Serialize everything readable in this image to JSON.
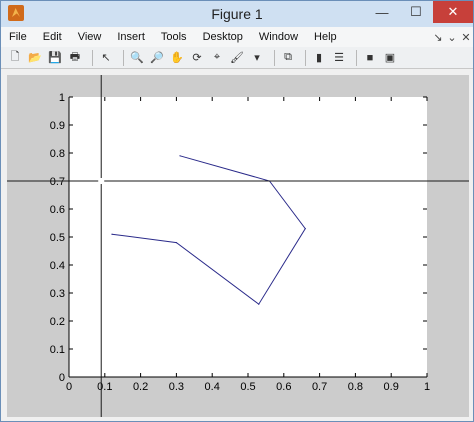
{
  "window": {
    "title": "Figure 1",
    "minimize": "—",
    "maximize": "☐",
    "close": "✕"
  },
  "menu": [
    "File",
    "Edit",
    "View",
    "Insert",
    "Tools",
    "Desktop",
    "Window",
    "Help"
  ],
  "menu_controls": [
    "↘",
    "⌄",
    "✕"
  ],
  "toolbar": [
    {
      "name": "new-figure-icon",
      "glyph": "🗋"
    },
    {
      "name": "open-file-icon",
      "glyph": "📂"
    },
    {
      "name": "save-icon",
      "glyph": "💾"
    },
    {
      "name": "print-icon",
      "glyph": "🖶"
    },
    {
      "sep": true
    },
    {
      "name": "edit-plot-arrow-icon",
      "glyph": "↖"
    },
    {
      "sep": true
    },
    {
      "name": "zoom-in-icon",
      "glyph": "🔍"
    },
    {
      "name": "zoom-out-icon",
      "glyph": "🔎"
    },
    {
      "name": "pan-hand-icon",
      "glyph": "✋"
    },
    {
      "name": "rotate-3d-icon",
      "glyph": "⟳"
    },
    {
      "name": "data-cursor-icon",
      "glyph": "⌖"
    },
    {
      "name": "brush-icon",
      "glyph": "🖌"
    },
    {
      "name": "brush-dropdown-icon",
      "glyph": "▾"
    },
    {
      "sep": true
    },
    {
      "name": "link-plot-icon",
      "glyph": "⧉"
    },
    {
      "sep": true
    },
    {
      "name": "colorbar-icon",
      "glyph": "▮"
    },
    {
      "name": "legend-icon",
      "glyph": "☰"
    },
    {
      "sep": true
    },
    {
      "name": "hide-plot-tools-icon",
      "glyph": "■"
    },
    {
      "name": "show-plot-tools-icon",
      "glyph": "▣"
    }
  ],
  "colors": {
    "plot_line": "#2a2a8a",
    "crosshair": "#1a1a1a",
    "axes_bg": "#ffffff",
    "figure_bg": "#cccccc"
  },
  "chart_data": {
    "type": "line",
    "x": [
      0.31,
      0.56,
      0.66,
      0.53,
      0.3,
      0.12
    ],
    "y": [
      0.79,
      0.7,
      0.53,
      0.26,
      0.48,
      0.51
    ],
    "xlim": [
      0,
      1
    ],
    "ylim": [
      0,
      1
    ],
    "xticks": [
      "0",
      "0.1",
      "0.2",
      "0.3",
      "0.4",
      "0.5",
      "0.6",
      "0.7",
      "0.8",
      "0.9",
      "1"
    ],
    "yticks": [
      "0",
      "0.1",
      "0.2",
      "0.3",
      "0.4",
      "0.5",
      "0.6",
      "0.7",
      "0.8",
      "0.9",
      "1"
    ],
    "crosshair": {
      "x": 0.09,
      "y": 0.7
    },
    "grid": false,
    "title": "",
    "xlabel": "",
    "ylabel": ""
  }
}
